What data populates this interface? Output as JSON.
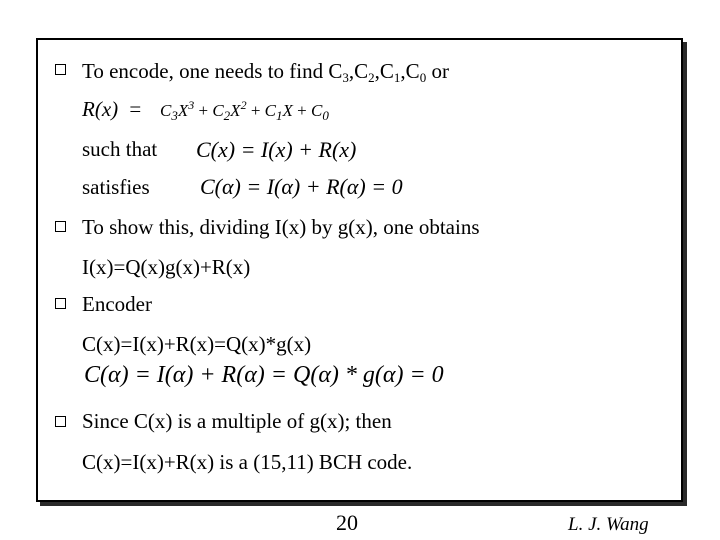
{
  "slide": {
    "bullets": [
      {
        "text_prefix": "To encode, one needs to find C",
        "subscripts": [
          "3",
          "2",
          "1",
          "0"
        ],
        "text_suffix": "or"
      },
      {
        "text": "To show this, dividing I(x) by g(x), one obtains"
      },
      {
        "text": "Encoder"
      },
      {
        "text": "Since C(x) is a multiple of g(x); then"
      }
    ],
    "rx_label": "R(x)",
    "rx_eq_sign": "=",
    "rx_formula": {
      "c3": "C",
      "c3_sub": "3",
      "x3": "X",
      "x3_sup": "3",
      "c2": "C",
      "c2_sub": "2",
      "x2": "X",
      "x2_sup": "2",
      "c1": "C",
      "c1_sub": "1",
      "x1": "X",
      "c0": "C",
      "c0_sub": "0",
      "plus": "+"
    },
    "such_that_label": "such that",
    "such_that_eq": "C(x) = I(x) + R(x)",
    "satisfies_label": "satisfies",
    "satisfies_eq": "C(α) = I(α) + R(α) = 0",
    "division_result": "I(x)=Q(x)g(x)+R(x)",
    "encoder_eq1": "C(x)=I(x)+R(x)=Q(x)*g(x)",
    "encoder_eq2": "C(α) = I(α) + R(α) = Q(α) * g(α) = 0",
    "conclusion": "C(x)=I(x)+R(x) is a (15,11) BCH code."
  },
  "footer": {
    "page_number": "20",
    "author": "L. J. Wang"
  },
  "icons": {
    "bullet": "hollow-square-bullet-icon"
  }
}
